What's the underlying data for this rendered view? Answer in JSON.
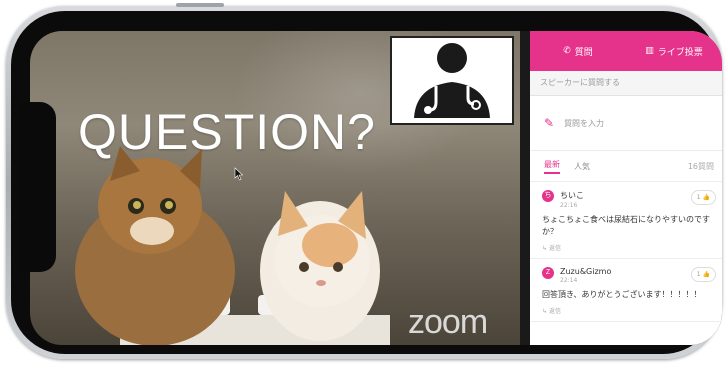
{
  "video": {
    "slide_text": "QUESTION?",
    "watermark": "zoom"
  },
  "qa_panel": {
    "tabs": [
      {
        "icon": "question-icon",
        "label": "質問"
      },
      {
        "icon": "poll-icon",
        "label": "ライブ投票"
      }
    ],
    "speaker_hint": "スピーカーに質問する",
    "input_placeholder": "質問を入力",
    "sort_tabs": [
      "最新",
      "人気"
    ],
    "question_count": "16質問",
    "questions": [
      {
        "avatar": "ち",
        "name": "ちいこ",
        "time": "22:16",
        "likes": "1",
        "text": "ちょこちょこ食べは尿結石になりやすいのですか？",
        "reply": "返信"
      },
      {
        "avatar": "Z",
        "name": "Zuzu&Gizmo",
        "time": "22:14",
        "likes": "1",
        "text": "回答頂き、ありがとうございます！！！！！",
        "reply": "返信"
      }
    ]
  },
  "colors": {
    "accent": "#e5328a"
  }
}
